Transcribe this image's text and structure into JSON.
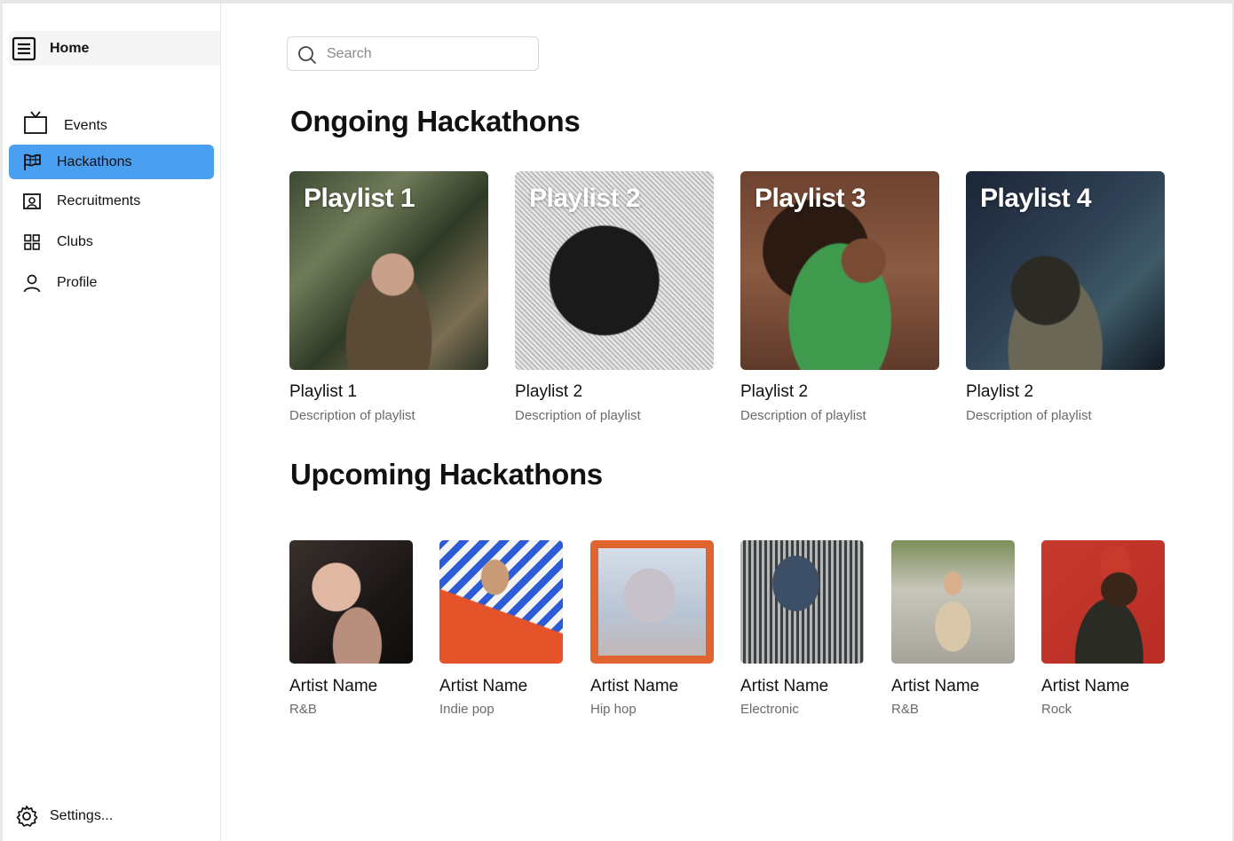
{
  "sidebar": {
    "home_label": "Home",
    "items": [
      {
        "label": "Events",
        "icon": "tv-icon"
      },
      {
        "label": "Hackathons",
        "icon": "flag-icon",
        "active": true
      },
      {
        "label": "Recruitments",
        "icon": "id-badge-icon"
      },
      {
        "label": "Clubs",
        "icon": "grid-icon"
      },
      {
        "label": "Profile",
        "icon": "user-icon"
      }
    ],
    "settings_label": "Settings..."
  },
  "search": {
    "placeholder": "Search",
    "value": ""
  },
  "ongoing": {
    "title": "Ongoing Hackathons",
    "cards": [
      {
        "overlay": "Playlist 1",
        "name": "Playlist 1",
        "description": "Description of playlist"
      },
      {
        "overlay": "Playlist 2",
        "name": "Playlist 2",
        "description": "Description of playlist"
      },
      {
        "overlay": "Playlist 3",
        "name": "Playlist 2",
        "description": "Description of playlist"
      },
      {
        "overlay": "Playlist 4",
        "name": "Playlist 2",
        "description": "Description of playlist"
      }
    ]
  },
  "upcoming": {
    "title": "Upcoming Hackathons",
    "artists": [
      {
        "name": "Artist Name",
        "genre": "R&B"
      },
      {
        "name": "Artist Name",
        "genre": "Indie pop"
      },
      {
        "name": "Artist Name",
        "genre": "Hip hop"
      },
      {
        "name": "Artist Name",
        "genre": "Electronic"
      },
      {
        "name": "Artist Name",
        "genre": "R&B"
      },
      {
        "name": "Artist Name",
        "genre": "Rock"
      }
    ]
  },
  "colors": {
    "accent": "#4a9ff0",
    "text": "#111111",
    "muted": "#6b6b6b",
    "border": "#d6d6d6"
  }
}
